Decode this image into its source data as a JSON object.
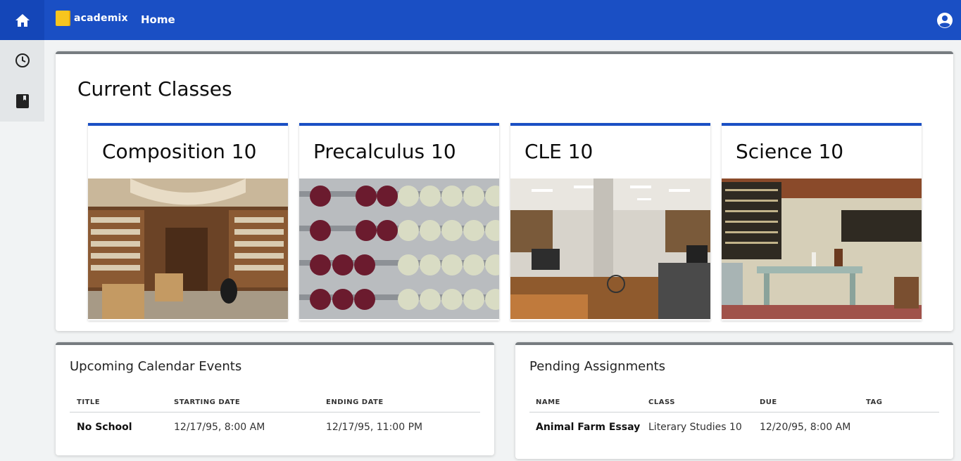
{
  "app": {
    "logo_text": "academix",
    "nav_home": "Home"
  },
  "icons": {
    "home": "home-icon",
    "clock": "clock-icon",
    "book": "book-icon",
    "profile": "account-circle-icon"
  },
  "colors": {
    "primary": "#1a4fc4",
    "panel_border": "#777c80",
    "logo": "#f7c51e"
  },
  "current_classes": {
    "title": "Current Classes",
    "classes": [
      {
        "name": "Composition 10",
        "image": "library interior"
      },
      {
        "name": "Precalculus 10",
        "image": "abacus beads"
      },
      {
        "name": "CLE 10",
        "image": "open-plan office"
      },
      {
        "name": "Science 10",
        "image": "laboratory"
      }
    ]
  },
  "events": {
    "title": "Upcoming Calendar Events",
    "columns": [
      "TITLE",
      "STARTING DATE",
      "ENDING DATE"
    ],
    "rows": [
      {
        "title": "No School",
        "start": "12/17/95, 8:00 AM",
        "end": "12/17/95, 11:00 PM"
      }
    ]
  },
  "assignments": {
    "title": "Pending Assignments",
    "columns": [
      "NAME",
      "CLASS",
      "DUE",
      "TAG"
    ],
    "rows": [
      {
        "name": "Animal Farm Essay",
        "class": "Literary Studies 10",
        "due": "12/20/95, 8:00 AM",
        "tag": ""
      }
    ]
  }
}
